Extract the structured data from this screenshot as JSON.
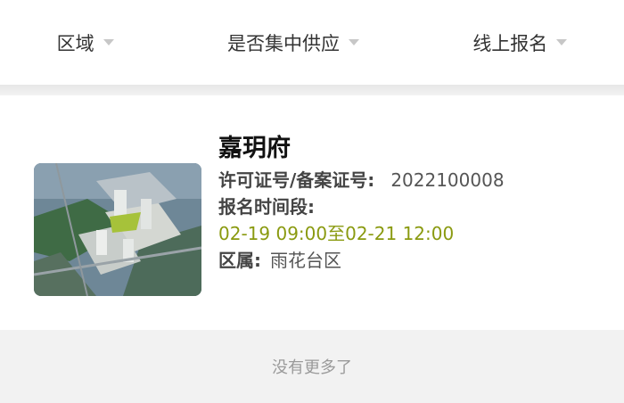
{
  "filters": [
    {
      "label": "区域"
    },
    {
      "label": "是否集中供应"
    },
    {
      "label": "线上报名"
    }
  ],
  "listing": {
    "name": "嘉玥府",
    "permit_label": "许可证号/备案证号:",
    "permit_value": "2022100008",
    "period_label": "报名时间段:",
    "period_value": "02-19 09:00至02-21 12:00",
    "district_label": "区属:",
    "district_value": "雨花台区"
  },
  "footer": {
    "text": "没有更多了"
  }
}
